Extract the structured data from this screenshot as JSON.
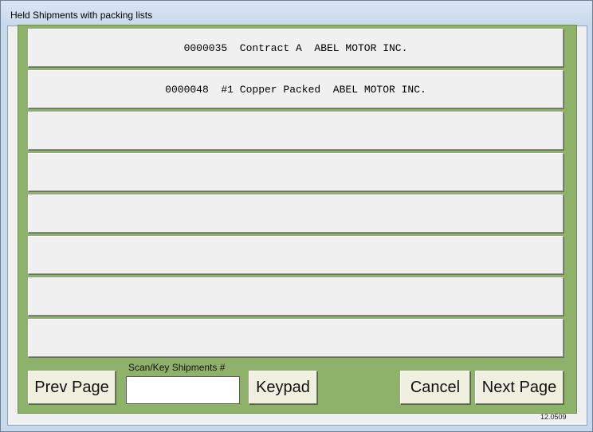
{
  "window": {
    "title": "Held Shipments with packing lists"
  },
  "shipments": [
    {
      "text": "0000035  Contract A  ABEL MOTOR INC."
    },
    {
      "text": "0000048  #1 Copper Packed  ABEL MOTOR INC."
    },
    {
      "text": ""
    },
    {
      "text": ""
    },
    {
      "text": ""
    },
    {
      "text": ""
    },
    {
      "text": ""
    },
    {
      "text": ""
    }
  ],
  "controls": {
    "prev_label": "Prev Page",
    "scan_label": "Scan/Key Shipments #",
    "scan_value": "",
    "keypad_label": "Keypad",
    "cancel_label": "Cancel",
    "next_label": "Next Page"
  },
  "version": "12.0509",
  "colors": {
    "panel": "#8fb26a",
    "button": "#f0f0e0",
    "row": "#f0f0f0"
  }
}
